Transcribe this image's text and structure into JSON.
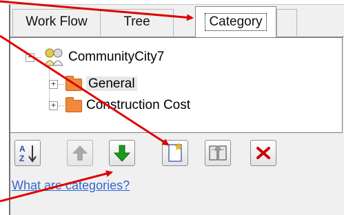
{
  "tabs": [
    {
      "label": "Work Flow",
      "active": false
    },
    {
      "label": "Tree",
      "active": false
    },
    {
      "label": "Category",
      "active": true
    }
  ],
  "tree": {
    "root": {
      "label": "CommunityCity7",
      "expanded": true,
      "icon": "project-icon"
    },
    "children": [
      {
        "label": "General",
        "selected": true,
        "icon": "folder-icon"
      },
      {
        "label": "Construction Cost",
        "selected": false,
        "icon": "folder-icon"
      }
    ]
  },
  "toolbar": {
    "buttons": [
      {
        "name": "sort-az-button",
        "icon": "sort-az-icon",
        "enabled": true
      },
      {
        "name": "move-up-button",
        "icon": "arrow-up-icon",
        "enabled": false
      },
      {
        "name": "move-down-button",
        "icon": "arrow-down-icon",
        "enabled": true
      },
      {
        "name": "new-category-button",
        "icon": "new-document-icon",
        "enabled": true
      },
      {
        "name": "edit-category-button",
        "icon": "book-icon",
        "enabled": true
      },
      {
        "name": "delete-button",
        "icon": "red-x-icon",
        "enabled": true
      }
    ]
  },
  "help_link": "What are categories?",
  "colors": {
    "annotation_arrow": "#e00000",
    "link": "#3366cc",
    "folder": "#f08a3a",
    "move_down_green": "#1a9a1a",
    "delete_red": "#cc0000"
  }
}
